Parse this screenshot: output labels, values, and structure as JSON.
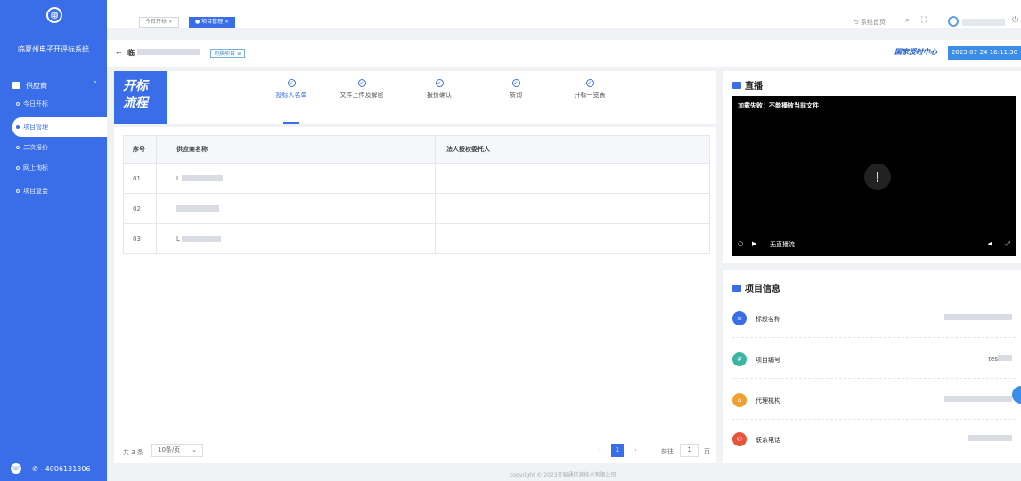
{
  "sidebar": {
    "logo_glyph": "㊞",
    "system_name": "临夏州电子开评标系统",
    "group_label": "供应商",
    "items": [
      {
        "label": "今日开标",
        "active": false
      },
      {
        "label": "项目管理",
        "active": true
      },
      {
        "label": "二次报价",
        "active": false
      },
      {
        "label": "网上询标",
        "active": false
      },
      {
        "label": "项目复会",
        "active": false
      }
    ],
    "phone": "- 4006131306"
  },
  "topbar": {
    "tabs": [
      {
        "label": "今日开标 ×",
        "active": false
      },
      {
        "label": "● 项目管理 ×",
        "active": true
      }
    ],
    "home_label": "系统首页",
    "search_icon": "search-icon",
    "fullscreen_icon": "fullscreen-icon",
    "power_icon": "power-icon"
  },
  "crumb": {
    "back_glyph": "←",
    "title_prefix": "临",
    "switch_label": "切换项目 ≡",
    "brand": "国家授时中心",
    "datetime": "2023-07-24 16:11:30"
  },
  "flow": {
    "title_line1": "开标",
    "title_line2": "流程",
    "steps": [
      "投标人名单",
      "文件上传及解密",
      "报价确认",
      "质询",
      "开标一览表"
    ],
    "check_glyph": "✓"
  },
  "table": {
    "headers": [
      "序号",
      "供应商名称",
      "法人授权委托人"
    ],
    "rows": [
      {
        "no": "01",
        "name_prefix": "L",
        "proxy": ""
      },
      {
        "no": "02",
        "name_prefix": "",
        "proxy": ""
      },
      {
        "no": "03",
        "name_prefix": "L",
        "proxy": ""
      }
    ]
  },
  "pagination": {
    "total": "共 3 条",
    "page_size": "10条/页",
    "prev": "‹",
    "current": "1",
    "next": "›",
    "goto_label": "前往",
    "goto_value": "1",
    "page_suffix": "页"
  },
  "footer": {
    "copyright": "copyright © 2023交易通信息技术有限公司"
  },
  "live": {
    "title": "直播",
    "error": "加载失败：不能播放当前文件",
    "warning_glyph": "!",
    "no_signal": "无直播流"
  },
  "info": {
    "title": "项目信息",
    "rows": [
      {
        "label": "标段名称",
        "value": "",
        "icon_color": "#3a6ee8",
        "icon": "doc-icon",
        "glyph": "≡"
      },
      {
        "label": "项目编号",
        "value": "tes",
        "icon_color": "#3ab5a0",
        "icon": "code-icon",
        "glyph": "#"
      },
      {
        "label": "代理机构",
        "value": "",
        "icon_color": "#f0a030",
        "icon": "agency-icon",
        "glyph": "⌂"
      },
      {
        "label": "联系电话",
        "value": "",
        "icon_color": "#e8543a",
        "icon": "phone-icon",
        "glyph": "✆"
      }
    ]
  }
}
